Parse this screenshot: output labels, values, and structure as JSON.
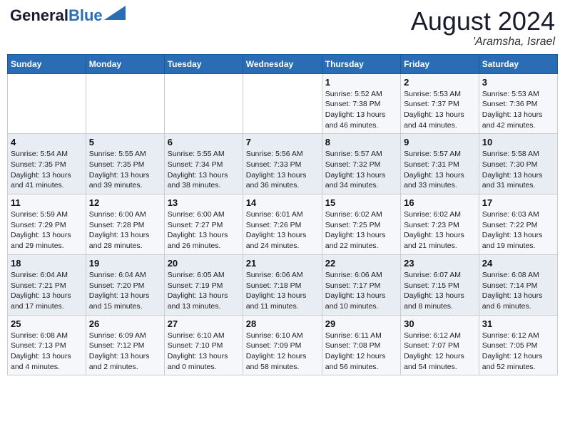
{
  "header": {
    "logo_line1": "General",
    "logo_line2": "Blue",
    "month": "August 2024",
    "location": "'Aramsha, Israel"
  },
  "weekdays": [
    "Sunday",
    "Monday",
    "Tuesday",
    "Wednesday",
    "Thursday",
    "Friday",
    "Saturday"
  ],
  "weeks": [
    [
      {
        "day": "",
        "info": ""
      },
      {
        "day": "",
        "info": ""
      },
      {
        "day": "",
        "info": ""
      },
      {
        "day": "",
        "info": ""
      },
      {
        "day": "1",
        "info": "Sunrise: 5:52 AM\nSunset: 7:38 PM\nDaylight: 13 hours\nand 46 minutes."
      },
      {
        "day": "2",
        "info": "Sunrise: 5:53 AM\nSunset: 7:37 PM\nDaylight: 13 hours\nand 44 minutes."
      },
      {
        "day": "3",
        "info": "Sunrise: 5:53 AM\nSunset: 7:36 PM\nDaylight: 13 hours\nand 42 minutes."
      }
    ],
    [
      {
        "day": "4",
        "info": "Sunrise: 5:54 AM\nSunset: 7:35 PM\nDaylight: 13 hours\nand 41 minutes."
      },
      {
        "day": "5",
        "info": "Sunrise: 5:55 AM\nSunset: 7:35 PM\nDaylight: 13 hours\nand 39 minutes."
      },
      {
        "day": "6",
        "info": "Sunrise: 5:55 AM\nSunset: 7:34 PM\nDaylight: 13 hours\nand 38 minutes."
      },
      {
        "day": "7",
        "info": "Sunrise: 5:56 AM\nSunset: 7:33 PM\nDaylight: 13 hours\nand 36 minutes."
      },
      {
        "day": "8",
        "info": "Sunrise: 5:57 AM\nSunset: 7:32 PM\nDaylight: 13 hours\nand 34 minutes."
      },
      {
        "day": "9",
        "info": "Sunrise: 5:57 AM\nSunset: 7:31 PM\nDaylight: 13 hours\nand 33 minutes."
      },
      {
        "day": "10",
        "info": "Sunrise: 5:58 AM\nSunset: 7:30 PM\nDaylight: 13 hours\nand 31 minutes."
      }
    ],
    [
      {
        "day": "11",
        "info": "Sunrise: 5:59 AM\nSunset: 7:29 PM\nDaylight: 13 hours\nand 29 minutes."
      },
      {
        "day": "12",
        "info": "Sunrise: 6:00 AM\nSunset: 7:28 PM\nDaylight: 13 hours\nand 28 minutes."
      },
      {
        "day": "13",
        "info": "Sunrise: 6:00 AM\nSunset: 7:27 PM\nDaylight: 13 hours\nand 26 minutes."
      },
      {
        "day": "14",
        "info": "Sunrise: 6:01 AM\nSunset: 7:26 PM\nDaylight: 13 hours\nand 24 minutes."
      },
      {
        "day": "15",
        "info": "Sunrise: 6:02 AM\nSunset: 7:25 PM\nDaylight: 13 hours\nand 22 minutes."
      },
      {
        "day": "16",
        "info": "Sunrise: 6:02 AM\nSunset: 7:23 PM\nDaylight: 13 hours\nand 21 minutes."
      },
      {
        "day": "17",
        "info": "Sunrise: 6:03 AM\nSunset: 7:22 PM\nDaylight: 13 hours\nand 19 minutes."
      }
    ],
    [
      {
        "day": "18",
        "info": "Sunrise: 6:04 AM\nSunset: 7:21 PM\nDaylight: 13 hours\nand 17 minutes."
      },
      {
        "day": "19",
        "info": "Sunrise: 6:04 AM\nSunset: 7:20 PM\nDaylight: 13 hours\nand 15 minutes."
      },
      {
        "day": "20",
        "info": "Sunrise: 6:05 AM\nSunset: 7:19 PM\nDaylight: 13 hours\nand 13 minutes."
      },
      {
        "day": "21",
        "info": "Sunrise: 6:06 AM\nSunset: 7:18 PM\nDaylight: 13 hours\nand 11 minutes."
      },
      {
        "day": "22",
        "info": "Sunrise: 6:06 AM\nSunset: 7:17 PM\nDaylight: 13 hours\nand 10 minutes."
      },
      {
        "day": "23",
        "info": "Sunrise: 6:07 AM\nSunset: 7:15 PM\nDaylight: 13 hours\nand 8 minutes."
      },
      {
        "day": "24",
        "info": "Sunrise: 6:08 AM\nSunset: 7:14 PM\nDaylight: 13 hours\nand 6 minutes."
      }
    ],
    [
      {
        "day": "25",
        "info": "Sunrise: 6:08 AM\nSunset: 7:13 PM\nDaylight: 13 hours\nand 4 minutes."
      },
      {
        "day": "26",
        "info": "Sunrise: 6:09 AM\nSunset: 7:12 PM\nDaylight: 13 hours\nand 2 minutes."
      },
      {
        "day": "27",
        "info": "Sunrise: 6:10 AM\nSunset: 7:10 PM\nDaylight: 13 hours\nand 0 minutes."
      },
      {
        "day": "28",
        "info": "Sunrise: 6:10 AM\nSunset: 7:09 PM\nDaylight: 12 hours\nand 58 minutes."
      },
      {
        "day": "29",
        "info": "Sunrise: 6:11 AM\nSunset: 7:08 PM\nDaylight: 12 hours\nand 56 minutes."
      },
      {
        "day": "30",
        "info": "Sunrise: 6:12 AM\nSunset: 7:07 PM\nDaylight: 12 hours\nand 54 minutes."
      },
      {
        "day": "31",
        "info": "Sunrise: 6:12 AM\nSunset: 7:05 PM\nDaylight: 12 hours\nand 52 minutes."
      }
    ]
  ]
}
